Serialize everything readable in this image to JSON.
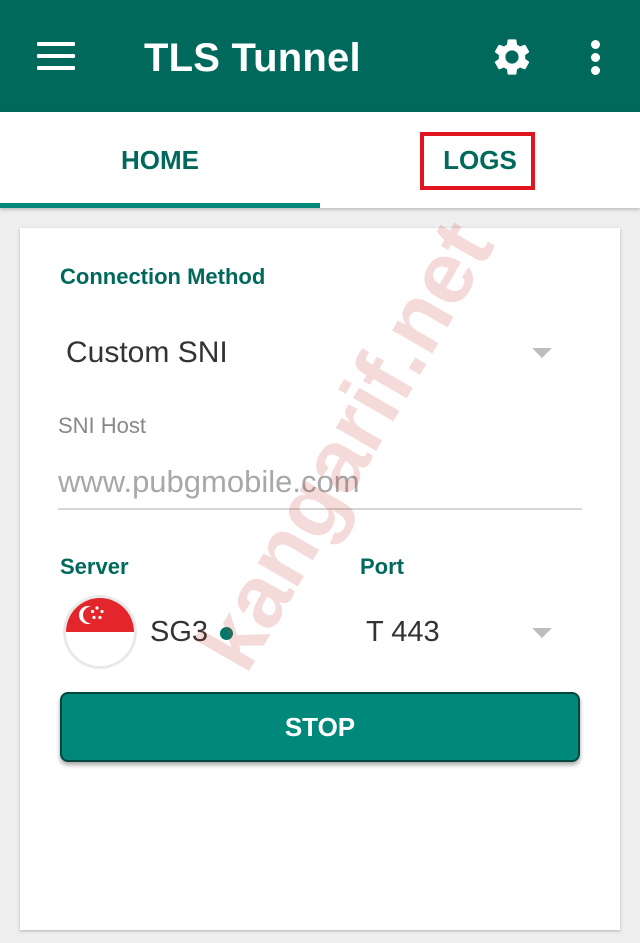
{
  "app_bar": {
    "menu_icon": "hamburger-icon",
    "title": "TLS Tunnel",
    "settings_icon": "gear-icon",
    "more_icon": "more-vert-icon",
    "color": "#00695c"
  },
  "tabs": [
    {
      "label": "HOME",
      "selected": true
    },
    {
      "label": "LOGS",
      "selected": false,
      "highlighted": true
    }
  ],
  "card": {
    "connection_method": {
      "label": "Connection Method",
      "selected": "Custom SNI"
    },
    "sni_host": {
      "label": "SNI Host",
      "placeholder": "www.pubgmobile.com",
      "value": ""
    },
    "server": {
      "label": "Server",
      "name": "SG3",
      "flag_icon": "singapore-flag-icon",
      "status_color": "#00796b"
    },
    "port": {
      "label": "Port",
      "selected": "T 443"
    },
    "stop_button": "STOP"
  },
  "watermark": "kangarif.net",
  "colors": {
    "accent": "#00897b",
    "highlight_box": "#e0151f"
  }
}
